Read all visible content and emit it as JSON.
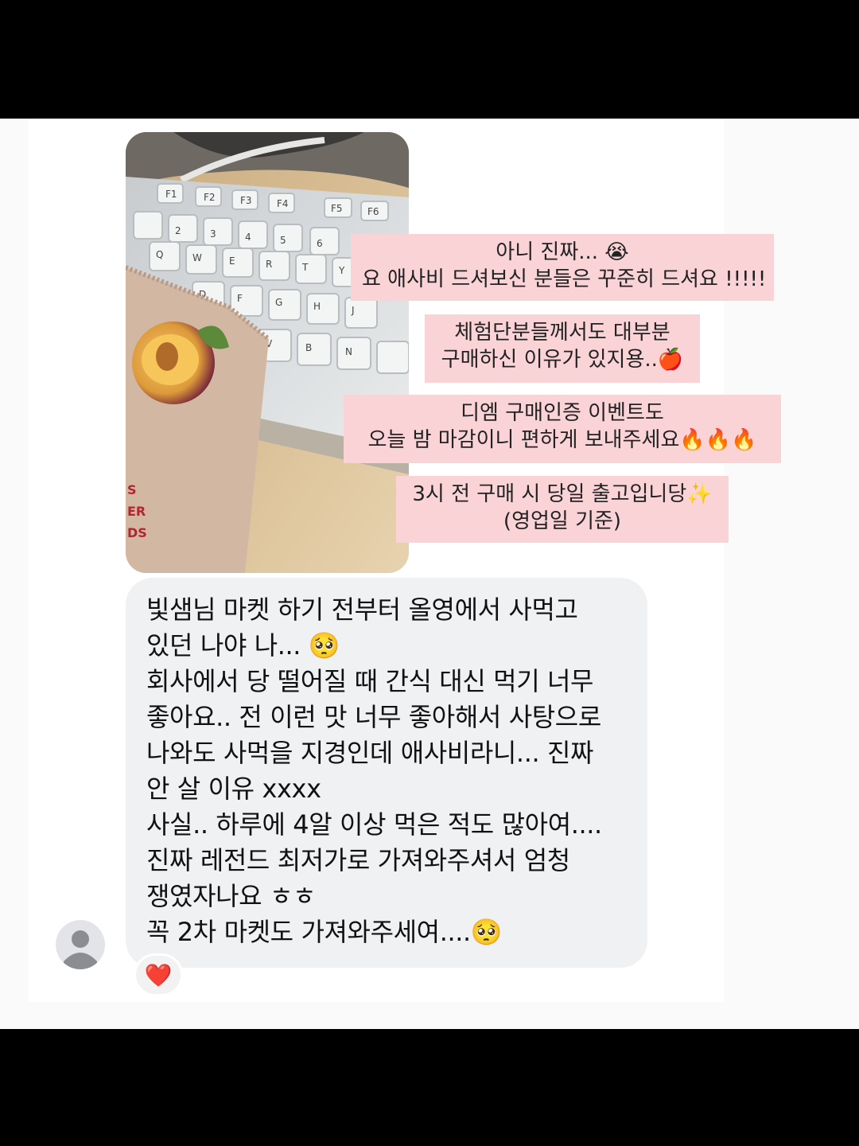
{
  "captions": [
    {
      "line1": "아니 진짜... 😭",
      "line2": "요 애사비 드셔보신 분들은 꾸준히 드셔요 !!!!!"
    },
    {
      "line1": "체험단분들께서도 대부분",
      "line2": "구매하신 이유가 있지용..🍎"
    },
    {
      "line1": "디엠 구매인증 이벤트도",
      "line2": "오늘 밤 마감이니 편하게 보내주세요🔥🔥🔥"
    },
    {
      "line1": "3시 전 구매 시 당일 출고입니당✨",
      "line2": "(영업일 기준)"
    }
  ],
  "photo": {
    "package_text": [
      "S",
      "ER",
      "DS"
    ],
    "keys_row1": [
      "F1",
      "F2",
      "F3",
      "F4",
      "F5",
      "F6"
    ],
    "keys_row2": [
      "2",
      "3",
      "4",
      "5",
      "6"
    ],
    "keys_row3": [
      "Q",
      "W",
      "E",
      "R",
      "T",
      "Y"
    ],
    "keys_row4": [
      "D",
      "F",
      "G",
      "H",
      "J"
    ],
    "keys_row5": [
      "V",
      "B",
      "N"
    ]
  },
  "message": {
    "lines": [
      "빛샘님 마켓 하기 전부터 올영에서 사먹고",
      "있던 나야 나... 🥺",
      "회사에서 당 떨어질 때 간식 대신 먹기 너무",
      "좋아요.. 전 이런 맛 너무 좋아해서 사탕으로",
      "나와도 사먹을 지경인데 애사비라니... 진짜",
      "안 살 이유 xxxx",
      "사실.. 하루에 4알 이상 먹은 적도 많아여....",
      "진짜 레전드 최저가로 가져와주셔서 엄청",
      "쟁였자나요 ㅎㅎ",
      "꼭 2차 마켓도 가져와주세여....🥺"
    ]
  },
  "reaction": {
    "icon": "heart-icon",
    "glyph": "❤️",
    "color": "#e0262e"
  },
  "avatar": {
    "icon": "user-avatar-icon"
  },
  "colors": {
    "caption_bg": "#fad3d7",
    "bubble_bg": "#f0f1f3",
    "frame": "#000000"
  }
}
